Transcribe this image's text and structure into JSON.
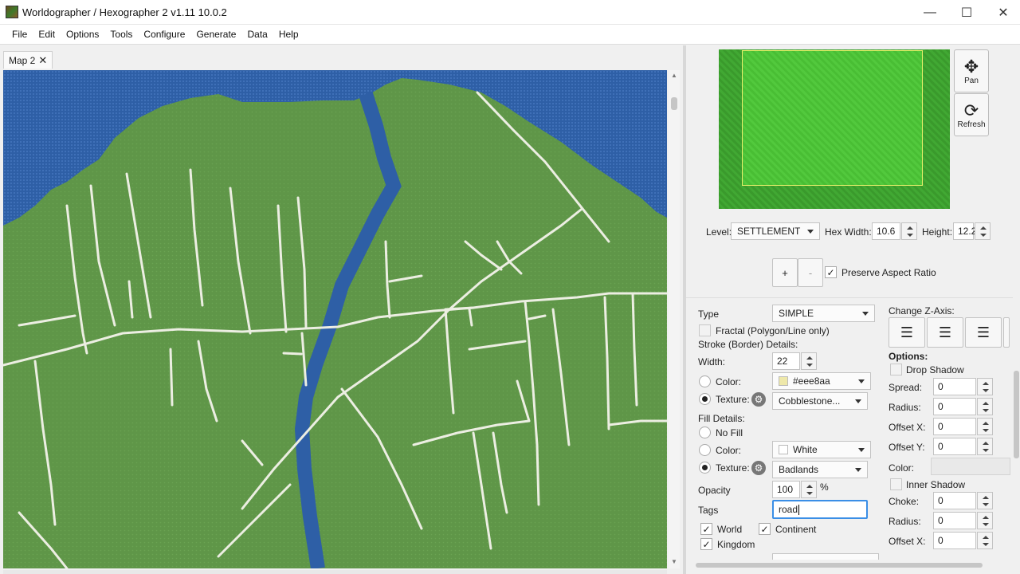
{
  "window": {
    "title": "Worldographer / Hexographer 2 v1.11 10.0.2",
    "minimize": "—",
    "maximize": "☐",
    "close": "✕"
  },
  "menu": [
    "File",
    "Edit",
    "Options",
    "Tools",
    "Configure",
    "Generate",
    "Data",
    "Help"
  ],
  "tab": {
    "label": "Map 2",
    "close": "✕"
  },
  "colors": {
    "sea": "#2e5fa6",
    "land": "#5f9648",
    "river": "#2e5fa6",
    "road": "#eceee2",
    "accent": "#3a8ee6"
  },
  "tools": {
    "pan": {
      "label": "Pan",
      "icon": "pan-icon"
    },
    "refresh": {
      "label": "Refresh",
      "icon": "refresh-icon"
    }
  },
  "view": {
    "level_label": "Level:",
    "level": "SETTLEMENT",
    "hex_width_label": "Hex Width:",
    "hex_width": "10.6",
    "height_label": "Height:",
    "height": "12.2",
    "zoom_in": "+",
    "zoom_out": "-",
    "preserve_aspect": "Preserve Aspect Ratio",
    "preserve_aspect_checked": true
  },
  "shape": {
    "type_label": "Type",
    "type": "SIMPLE",
    "fractal": "Fractal (Polygon/Line only)",
    "stroke_heading": "Stroke (Border) Details:",
    "width_label": "Width:",
    "width": "22",
    "stroke_color_label": "Color:",
    "stroke_color": "#eee8aa",
    "stroke_texture_label": "Texture:",
    "stroke_texture": "Cobblestone...",
    "fill_heading": "Fill Details:",
    "no_fill": "No Fill",
    "fill_color_label": "Color:",
    "fill_color": "White",
    "fill_texture_label": "Texture:",
    "fill_texture": "Badlands",
    "opacity_label": "Opacity",
    "opacity": "100",
    "opacity_unit": "%",
    "tags_label": "Tags",
    "tags": "road",
    "tag_world": "World",
    "tag_continent": "Continent",
    "tag_kingdom": "Kingdom"
  },
  "effects": {
    "z_axis_label": "Change Z-Axis:",
    "options_label": "Options:",
    "drop_shadow": "Drop Shadow",
    "spread_label": "Spread:",
    "spread": "0",
    "radius_label": "Radius:",
    "radius": "0",
    "offset_x_label": "Offset X:",
    "offset_x": "0",
    "offset_y_label": "Offset Y:",
    "offset_y": "0",
    "color_label": "Color:",
    "inner_shadow": "Inner Shadow",
    "choke_label": "Choke:",
    "choke": "0",
    "inner_radius_label": "Radius:",
    "inner_radius": "0",
    "inner_offset_x_label": "Offset X:",
    "inner_offset_x": "0"
  }
}
